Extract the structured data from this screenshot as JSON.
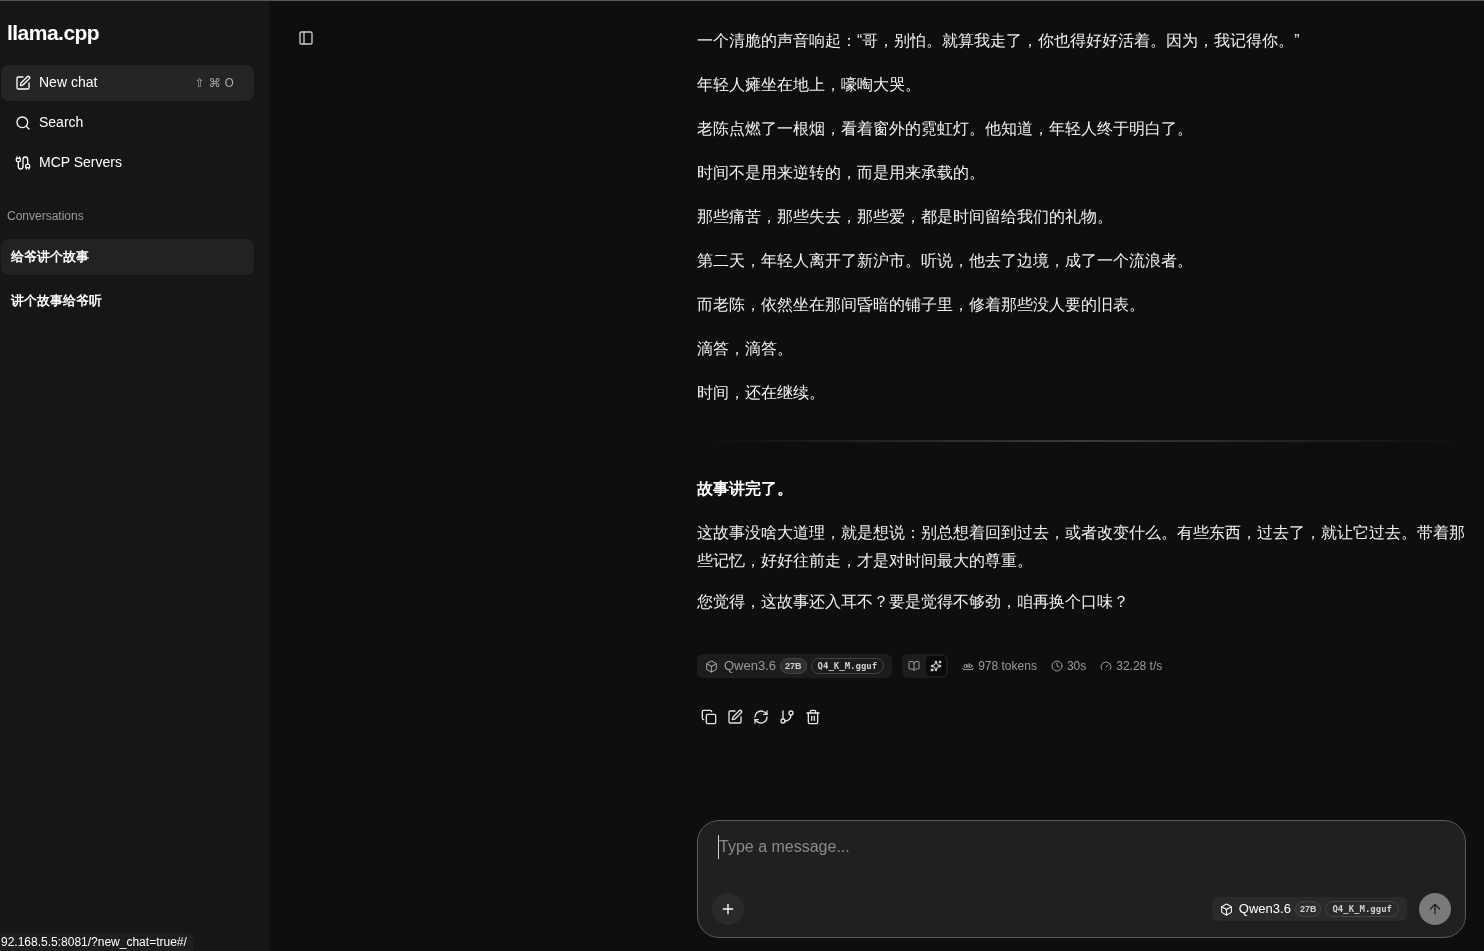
{
  "sidebar": {
    "title": "llama.cpp",
    "nav": [
      {
        "kind": "new",
        "label": "New chat",
        "shortcut": "⇧ ⌘ O",
        "selected": true
      },
      {
        "kind": "search",
        "label": "Search",
        "selected": false
      },
      {
        "kind": "mcp",
        "label": "MCP Servers",
        "selected": false
      }
    ],
    "section_label": "Conversations",
    "conversations": [
      {
        "title": "给爷讲个故事",
        "selected": true
      },
      {
        "title": "讲个故事给爷听",
        "selected": false
      }
    ]
  },
  "message": {
    "paragraphs": [
      "一个清脆的声音响起：“哥，别怕。就算我走了，你也得好好活着。因为，我记得你。”",
      "年轻人瘫坐在地上，嚎啕大哭。",
      "老陈点燃了一根烟，看着窗外的霓虹灯。他知道，年轻人终于明白了。",
      "时间不是用来逆转的，而是用来承载的。",
      "那些痛苦，那些失去，那些爱，都是时间留给我们的礼物。",
      "第二天，年轻人离开了新沪市。听说，他去了边境，成了一个流浪者。",
      "而老陈，依然坐在那间昏暗的铺子里，修着那些没人要的旧表。",
      "滴答，滴答。",
      "时间，还在继续。"
    ],
    "heading": "故事讲完了。",
    "closing": [
      "这故事没啥大道理，就是想说：别总想着回到过去，或者改变什么。有些东西，过去了，就让它过去。带着那些记忆，好好往前走，才是对时间最大的尊重。",
      "您觉得，这故事还入耳不？要是觉得不够劲，咱再换个口味？"
    ],
    "model": {
      "name": "Qwen3.6",
      "size": "27B",
      "file": "Q4_K_M.gguf"
    },
    "modes": [
      {
        "kind": "reading",
        "selected": false
      },
      {
        "kind": "generation",
        "selected": true
      }
    ],
    "stats": [
      {
        "kind": "tokens",
        "text": "978 tokens"
      },
      {
        "kind": "time",
        "text": "30s"
      },
      {
        "kind": "speed",
        "text": "32.28 t/s"
      }
    ],
    "actions": [
      {
        "kind": "copy"
      },
      {
        "kind": "edit"
      },
      {
        "kind": "regenerate"
      },
      {
        "kind": "branch"
      },
      {
        "kind": "delete"
      }
    ]
  },
  "composer": {
    "placeholder": "Type a message...",
    "model": {
      "name": "Qwen3.6",
      "size": "27B",
      "file": "Q4_K_M.gguf"
    }
  },
  "status_url": "92.168.5.5:8081/?new_chat=true#/"
}
